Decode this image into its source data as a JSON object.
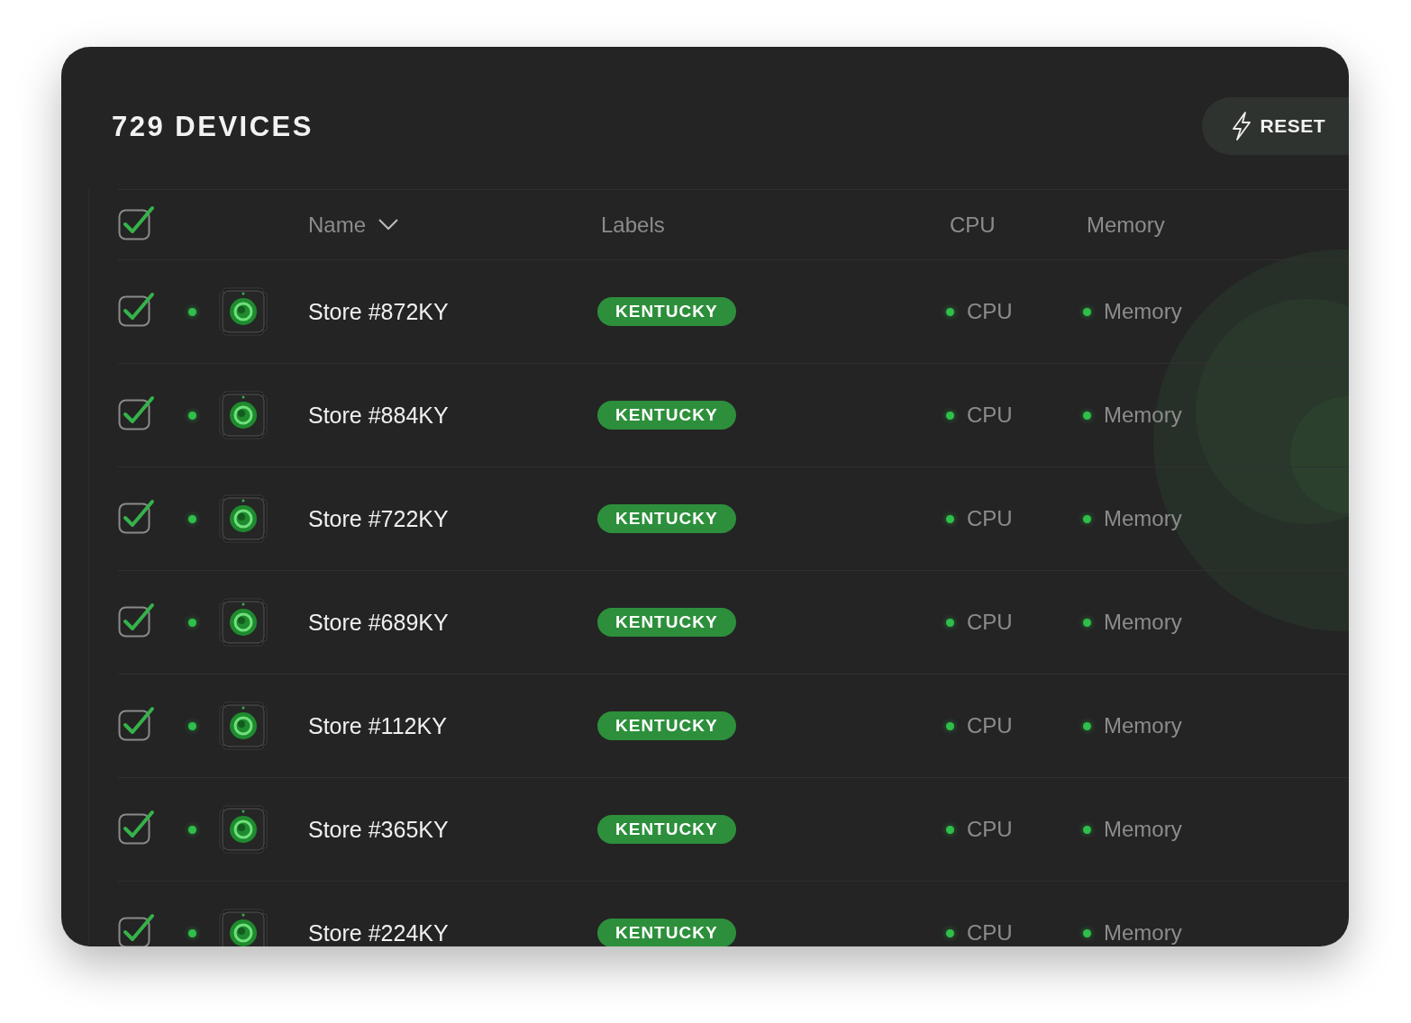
{
  "title": "729 DEVICES",
  "reset_button": {
    "label": "RESET"
  },
  "table": {
    "select_all": {
      "checked": true
    },
    "columns": [
      {
        "label": "Name",
        "sorted": true
      },
      {
        "label": "Labels",
        "sorted": false
      },
      {
        "label": "CPU",
        "sorted": false
      },
      {
        "label": "Memory",
        "sorted": false
      }
    ],
    "rows": [
      {
        "checked": true,
        "name": "Store #872KY",
        "label": "KENTUCKY",
        "cpu": "CPU",
        "memory": "Memory"
      },
      {
        "checked": true,
        "name": "Store #884KY",
        "label": "KENTUCKY",
        "cpu": "CPU",
        "memory": "Memory"
      },
      {
        "checked": true,
        "name": "Store #722KY",
        "label": "KENTUCKY",
        "cpu": "CPU",
        "memory": "Memory"
      },
      {
        "checked": true,
        "name": "Store #689KY",
        "label": "KENTUCKY",
        "cpu": "CPU",
        "memory": "Memory"
      },
      {
        "checked": true,
        "name": "Store #112KY",
        "label": "KENTUCKY",
        "cpu": "CPU",
        "memory": "Memory"
      },
      {
        "checked": true,
        "name": "Store #365KY",
        "label": "KENTUCKY",
        "cpu": "CPU",
        "memory": "Memory"
      },
      {
        "checked": true,
        "name": "Store #224KY",
        "label": "KENTUCKY",
        "cpu": "CPU",
        "memory": "Memory"
      }
    ]
  }
}
